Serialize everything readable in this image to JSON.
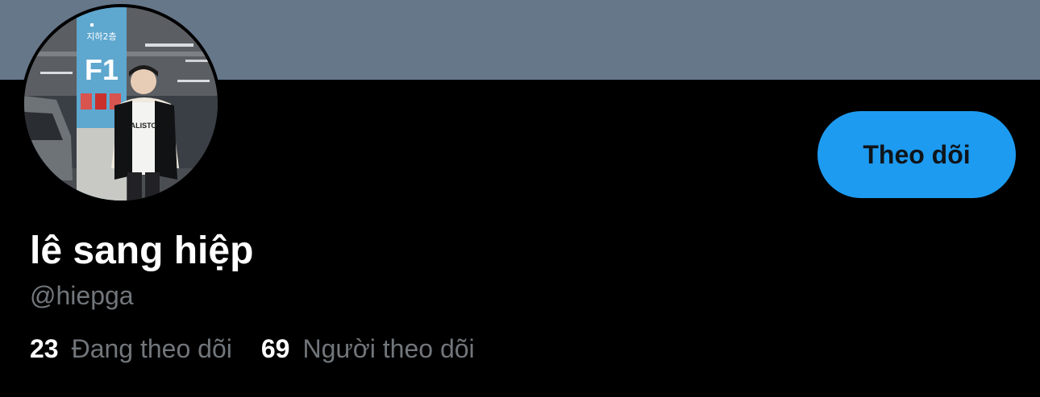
{
  "profile": {
    "display_name": "lê sang hiệp",
    "handle": "@hiepga",
    "avatar_sign_text": "지하2층",
    "avatar_sign_level": "F1"
  },
  "actions": {
    "follow_label": "Theo dõi"
  },
  "stats": {
    "following_count": "23",
    "following_label": "Đang theo dõi",
    "followers_count": "69",
    "followers_label": "Người theo dõi"
  },
  "colors": {
    "banner": "#66778a",
    "background": "#000000",
    "accent": "#1d9bf0",
    "muted_text": "#71767b"
  }
}
